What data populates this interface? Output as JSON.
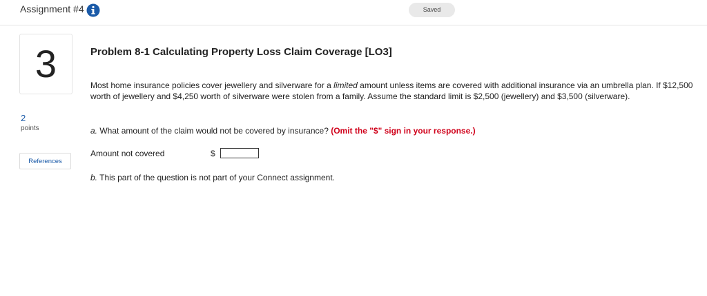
{
  "header": {
    "assignment_title": "Assignment #4",
    "info_icon": "info-icon",
    "saved_label": "Saved"
  },
  "question": {
    "number": "3",
    "points_value": "2",
    "points_label": "points",
    "references_label": "References"
  },
  "problem": {
    "title": "Problem 8-1 Calculating Property Loss Claim Coverage [LO3]",
    "body_part1": "Most home insurance policies cover jewellery and silverware for a ",
    "body_emphasis": "limited",
    "body_part2": " amount unless items are covered with additional insurance via an umbrella plan. If $12,500 worth of jewellery and $4,250 worth of silverware were stolen from a family. Assume the standard limit is $2,500 (jewellery) and $3,500 (silverware).",
    "part_a_label": "a.",
    "part_a_text": " What amount of the claim would not be covered by insurance? ",
    "part_a_instruction": "(Omit the \"$\" sign in your response.)",
    "amount_label": "Amount not covered",
    "currency_symbol": "$",
    "amount_value": "",
    "part_b_label": "b.",
    "part_b_text": " This part of the question is not part of your Connect assignment."
  },
  "colors": {
    "link_blue": "#1a5aa8",
    "instruction_red": "#d0021b",
    "info_icon_blue": "#1a5aa8"
  }
}
